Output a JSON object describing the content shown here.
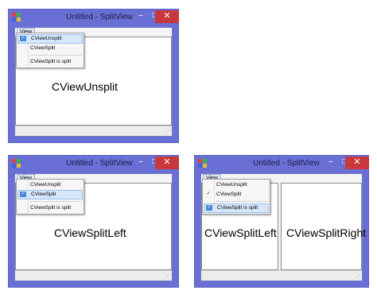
{
  "windows": [
    {
      "title": "Untitled - SplitView",
      "controls": {
        "minimize": "–",
        "maximize": "□",
        "close": "✕"
      },
      "menu": "View",
      "menu_items": [
        {
          "label": "CViewUnsplit",
          "checked": true,
          "highlighted": true
        },
        {
          "label": "CViewSplit",
          "checked": false,
          "highlighted": false
        },
        {
          "label": "CViewSplit is split",
          "checked": false,
          "highlighted": false
        }
      ],
      "panes": [
        "CViewUnsplit"
      ]
    },
    {
      "title": "Untitled - SplitView",
      "controls": {
        "minimize": "–",
        "maximize": "□",
        "close": "✕"
      },
      "menu": "View",
      "menu_items": [
        {
          "label": "CViewUnsplit",
          "checked": false,
          "highlighted": false
        },
        {
          "label": "CViewSplit",
          "checked": true,
          "highlighted": true
        },
        {
          "label": "CViewSplit is split",
          "checked": false,
          "highlighted": false
        }
      ],
      "panes": [
        "CViewSplitLeft"
      ]
    },
    {
      "title": "Untitled - SplitView",
      "controls": {
        "minimize": "–",
        "maximize": "□",
        "close": "✕"
      },
      "menu": "View",
      "menu_items": [
        {
          "label": "CViewUnsplit",
          "checked": false,
          "highlighted": false
        },
        {
          "label": "CViewSplit",
          "checked": true,
          "highlighted": false
        },
        {
          "label": "CViewSplit is split",
          "checked": true,
          "highlighted": true
        }
      ],
      "panes": [
        "CViewSplitLeft",
        "CViewSplitRight"
      ]
    }
  ],
  "icons": {
    "check": "checkmark-icon",
    "app": "app-icon",
    "resize": "resize-grip-icon"
  },
  "colors": {
    "frame": "#6a6fd6",
    "close_button": "#c8383c",
    "highlight": "#d6e6fb",
    "check": "#4a8ad6"
  }
}
